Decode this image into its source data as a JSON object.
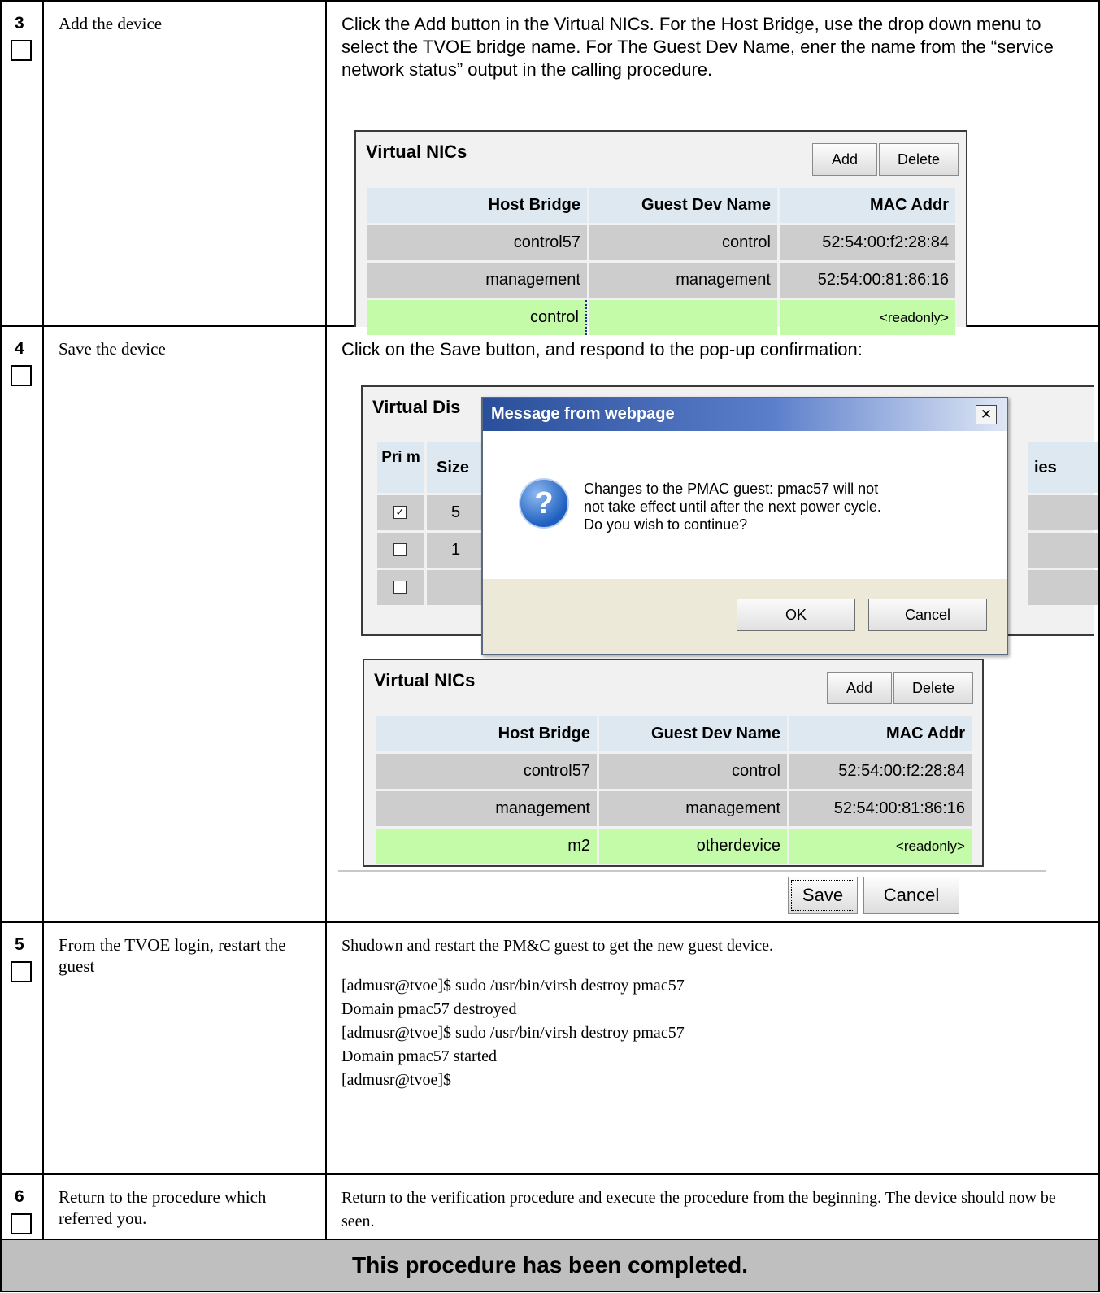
{
  "steps": [
    {
      "number": "3",
      "action": "Add the device",
      "instruction": "Click the Add button in the Virtual NICs. For the Host Bridge, use the drop down menu to select the TVOE bridge name. For The Guest Dev Name, ener the name from the “service network status” output in the calling procedure."
    },
    {
      "number": "4",
      "action": "Save the device",
      "instruction": "Click on the Save button, and respond to the pop-up confirmation:"
    },
    {
      "number": "5",
      "action": "From the TVOE login, restart the guest",
      "instruction": "Shudown and restart the PM&C guest to get the new guest device.",
      "console": [
        "[admusr@tvoe]$ sudo /usr/bin/virsh destroy pmac57",
        "Domain pmac57 destroyed",
        "[admusr@tvoe]$ sudo /usr/bin/virsh destroy pmac57",
        "Domain pmac57 started",
        "[admusr@tvoe]$"
      ]
    },
    {
      "number": "6",
      "action": "Return to the procedure which referred you.",
      "instruction": "Return to the verification procedure and execute the procedure from the beginning. The device should now be seen."
    }
  ],
  "vnic_panel_1": {
    "title": "Virtual NICs",
    "add": "Add",
    "delete": "Delete",
    "headers": [
      "Host Bridge",
      "Guest Dev Name",
      "MAC Addr"
    ],
    "rows": [
      [
        "control57",
        "control",
        "52:54:00:f2:28:84"
      ],
      [
        "management",
        "management",
        "52:54:00:81:86:16"
      ],
      [
        "control",
        "",
        "<readonly>"
      ]
    ]
  },
  "vdisk_panel": {
    "title_visible": "Virtual Dis",
    "col_prim": "Pri m",
    "col_size": "Size",
    "col_right": "ies",
    "row_values": [
      "5",
      "1",
      ""
    ],
    "row_checked": [
      true,
      false,
      false
    ]
  },
  "dialog": {
    "title": "Message from webpage",
    "close": "✕",
    "message": [
      "Changes to the PMAC guest: pmac57 will not",
      "not take effect until after the next power cycle.",
      "Do you wish to continue?"
    ],
    "ok": "OK",
    "cancel": "Cancel",
    "icon": "question-icon"
  },
  "vnic_panel_2": {
    "title": "Virtual NICs",
    "add": "Add",
    "delete": "Delete",
    "headers": [
      "Host Bridge",
      "Guest Dev Name",
      "MAC Addr"
    ],
    "rows": [
      [
        "control57",
        "control",
        "52:54:00:f2:28:84"
      ],
      [
        "management",
        "management",
        "52:54:00:81:86:16"
      ],
      [
        "m2",
        "otherdevice",
        "<readonly>"
      ]
    ]
  },
  "form_buttons": {
    "save": "Save",
    "cancel": "Cancel"
  },
  "footer": "This procedure has been completed."
}
